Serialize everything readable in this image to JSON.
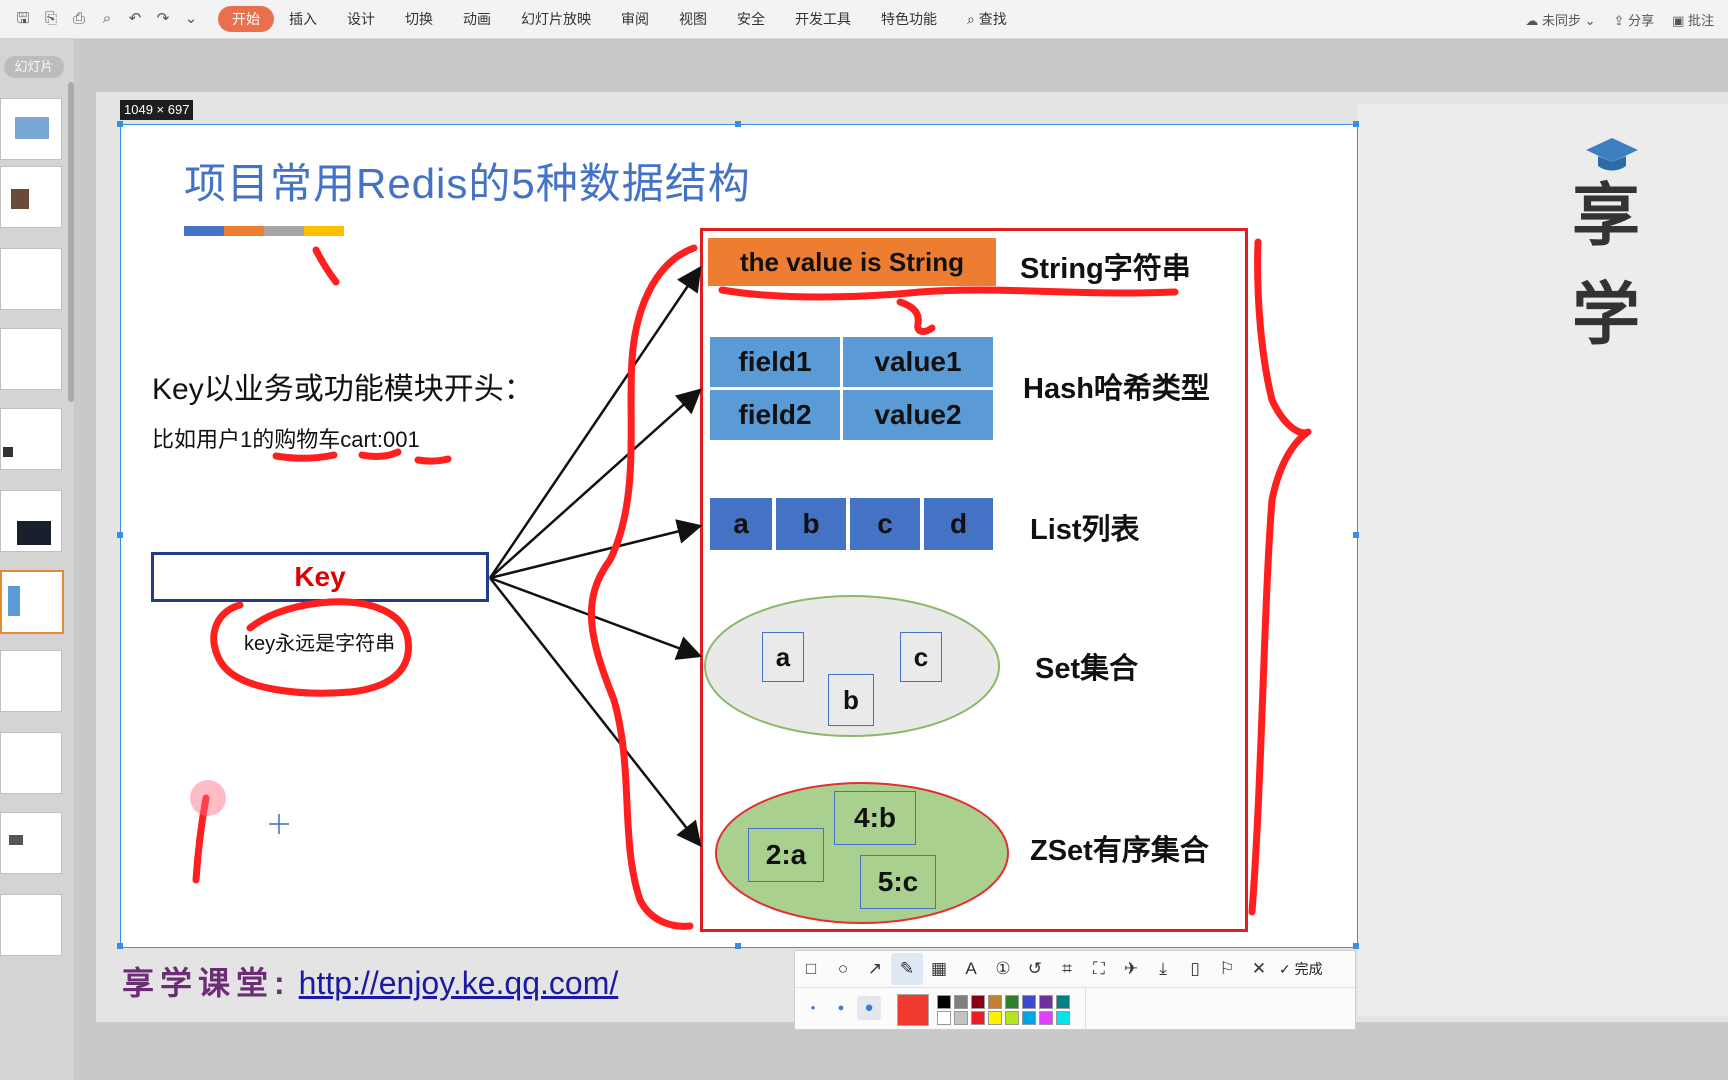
{
  "ribbon": {
    "tabs": [
      "开始",
      "插入",
      "设计",
      "切换",
      "动画",
      "幻灯片放映",
      "审阅",
      "视图",
      "安全",
      "开发工具",
      "特色功能"
    ],
    "search_label": "查找",
    "sync_label": "未同步",
    "share_label": "分享",
    "comment_label": "批注"
  },
  "thumbpanel": {
    "label": "幻灯片"
  },
  "size_badge": "1049 × 697",
  "slide": {
    "title": "项目常用Redis的5种数据结构",
    "key_rule": "Key以业务或功能模块开头：",
    "key_example": "比如用户1的购物车cart:001",
    "key_box": "Key",
    "key_note": "key永远是字符串",
    "string_value": "the value is String",
    "hash": [
      [
        "field1",
        "value1"
      ],
      [
        "field2",
        "value2"
      ]
    ],
    "list": [
      "a",
      "b",
      "c",
      "d"
    ],
    "set": [
      "a",
      "c",
      "b"
    ],
    "zset": [
      "2:a",
      "4:b",
      "5:c"
    ],
    "labels": {
      "string": "String字符串",
      "hash": "Hash哈希类型",
      "list": "List列表",
      "set": "Set集合",
      "zset": "ZSet有序集合"
    },
    "colors": {
      "title": "#4472c4",
      "string_box": "#ed7d31",
      "hash_cell": "#5b9bd5",
      "list_cell": "#4472c4",
      "frame": "#e02020",
      "ink": "#ff1f1f"
    }
  },
  "footer": {
    "brand": "享学课堂:",
    "url": "http://enjoy.ke.qq.com/"
  },
  "logo": {
    "text": "享学"
  },
  "annotation_toolbar": {
    "done_label": "完成"
  }
}
